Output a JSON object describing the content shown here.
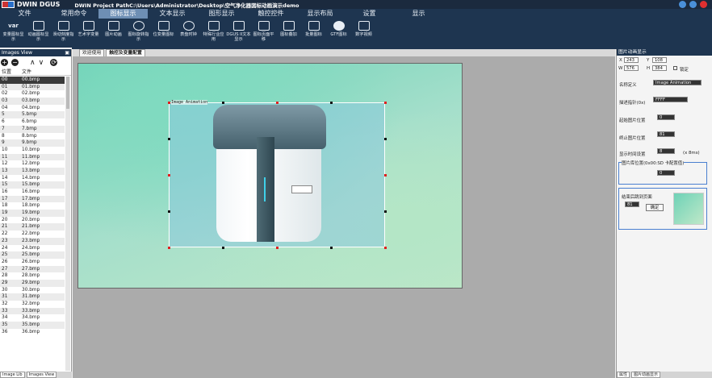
{
  "app": {
    "name": "DWIN DGUS",
    "window_title": "DWIN Project PathC:\\Users\\Administrator\\Desktop\\空气净化器図标动画演示demo"
  },
  "menu": [
    "文件",
    "常用命令",
    "图标显示",
    "文本显示",
    "图形显示",
    "触控控件",
    "显示布局",
    "设置",
    "显示"
  ],
  "menu_active_index": 2,
  "ribbon": [
    {
      "label": "变量图标显示",
      "icon": "var-icon"
    },
    {
      "label": "动画图标显示",
      "icon": "animation-icon"
    },
    {
      "label": "滑动刻度指示",
      "icon": "slider-icon"
    },
    {
      "label": "艺术字变量",
      "icon": "art-text-icon"
    },
    {
      "label": "图片动画",
      "icon": "image-animation-icon"
    },
    {
      "label": "图标旋转指示",
      "icon": "rotate-icon"
    },
    {
      "label": "位变量图标",
      "icon": "bit-icon"
    },
    {
      "label": "表盘时钟",
      "icon": "clock-icon"
    },
    {
      "label": "特殊行业应用",
      "icon": "special-icon"
    },
    {
      "label": "DGUS II文本显示",
      "icon": "dgus-text-icon"
    },
    {
      "label": "图标页面平移",
      "icon": "pan-icon"
    },
    {
      "label": "图标叠加",
      "icon": "overlay-icon"
    },
    {
      "label": "批量图标",
      "icon": "batch-icon"
    },
    {
      "label": "GTF图标",
      "icon": "gtf-icon"
    },
    {
      "label": "数字视频",
      "icon": "video-icon"
    }
  ],
  "images_view": {
    "title": "Images View",
    "col_pos": "位置",
    "col_file": "文件",
    "rows": [
      [
        "00",
        "00.bmp"
      ],
      [
        "01",
        "01.bmp"
      ],
      [
        "02",
        "02.bmp"
      ],
      [
        "03",
        "03.bmp"
      ],
      [
        "04",
        "04.bmp"
      ],
      [
        "5",
        "5.bmp"
      ],
      [
        "6",
        "6.bmp"
      ],
      [
        "7",
        "7.bmp"
      ],
      [
        "8",
        "8.bmp"
      ],
      [
        "9",
        "9.bmp"
      ],
      [
        "10",
        "10.bmp"
      ],
      [
        "11",
        "11.bmp"
      ],
      [
        "12",
        "12.bmp"
      ],
      [
        "13",
        "13.bmp"
      ],
      [
        "14",
        "14.bmp"
      ],
      [
        "15",
        "15.bmp"
      ],
      [
        "16",
        "16.bmp"
      ],
      [
        "17",
        "17.bmp"
      ],
      [
        "18",
        "18.bmp"
      ],
      [
        "19",
        "19.bmp"
      ],
      [
        "20",
        "20.bmp"
      ],
      [
        "21",
        "21.bmp"
      ],
      [
        "22",
        "22.bmp"
      ],
      [
        "23",
        "23.bmp"
      ],
      [
        "24",
        "24.bmp"
      ],
      [
        "25",
        "25.bmp"
      ],
      [
        "26",
        "26.bmp"
      ],
      [
        "27",
        "27.bmp"
      ],
      [
        "28",
        "28.bmp"
      ],
      [
        "29",
        "29.bmp"
      ],
      [
        "30",
        "30.bmp"
      ],
      [
        "31",
        "31.bmp"
      ],
      [
        "32",
        "32.bmp"
      ],
      [
        "33",
        "33.bmp"
      ],
      [
        "34",
        "34.bmp"
      ],
      [
        "35",
        "35.bmp"
      ],
      [
        "36",
        "36.bmp"
      ]
    ],
    "selected_index": 0
  },
  "tabs": [
    "欢迎使用",
    "触控及变量配置"
  ],
  "active_tab": 1,
  "canvas": {
    "object_label": "Image Animation"
  },
  "properties": {
    "title": "图片动画显示",
    "x_label": "X",
    "x_value": "243",
    "y_label": "Y",
    "y_value": "108",
    "w_label": "W",
    "w_value": "576",
    "h_label": "H",
    "h_value": "384",
    "lock_label": "锁定",
    "name_label": "名称定义",
    "name_value": "Image Animation",
    "desc_label": "描述指针(0x)",
    "desc_value": "FFFF",
    "start_label": "起始图片位置",
    "start_value": "0",
    "end_label": "终止图片位置",
    "end_value": "81",
    "interval_label": "显示时间设置",
    "interval_value": "8",
    "interval_unit": "(x 8ms)",
    "storage_label": "图片库位置(0x00:SD 卡配置值)",
    "storage_value": "0",
    "finish_label": "结束后跳到页面",
    "finish_value": "81",
    "confirm_label": "确定"
  },
  "bottom_tabs_left": [
    "Image Lib",
    "Images View"
  ],
  "bottom_tabs_right": [
    "属性",
    "图片动画显示"
  ],
  "colors": {
    "chrome": "#1e3550",
    "active_menu": "#6e8fb4",
    "handle_red": "#e02020"
  }
}
